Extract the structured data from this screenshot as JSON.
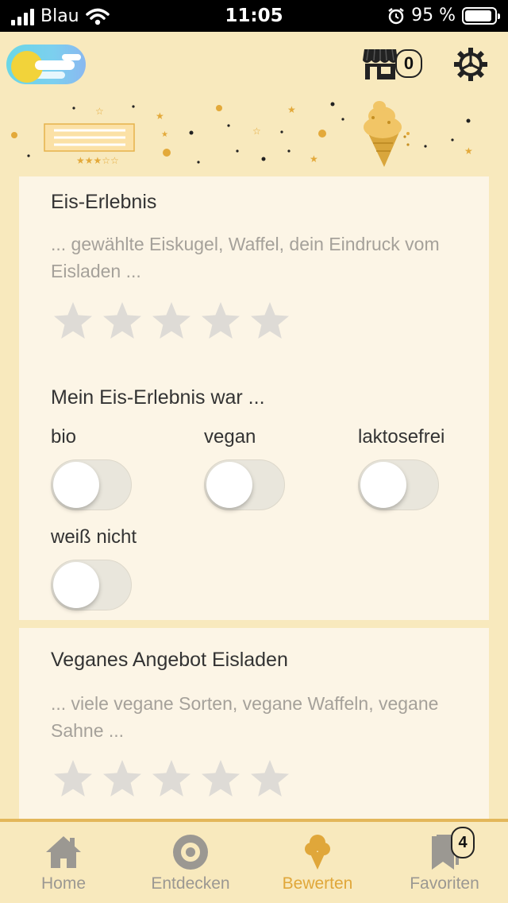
{
  "status_bar": {
    "carrier": "Blau",
    "time": "11:05",
    "battery": "95 %",
    "icons": [
      "signal-icon",
      "wifi-icon",
      "alarm-icon",
      "battery-icon"
    ]
  },
  "header": {
    "logo_icon": "sun-cloud-icon",
    "shop_icon": "shop-icon",
    "shop_count": "0",
    "settings_icon": "gear-icon"
  },
  "card1": {
    "title": "Eis-Erlebnis",
    "description": "... gewählte Eiskugel, Waffel, dein Eindruck vom Eisladen ...",
    "rating": 0,
    "rating_max": 5,
    "section_title": "Mein Eis-Erlebnis war ...",
    "toggles": [
      {
        "label": "bio",
        "on": false
      },
      {
        "label": "vegan",
        "on": false
      },
      {
        "label": "laktosefrei",
        "on": false
      },
      {
        "label": "weiß nicht",
        "on": false
      }
    ]
  },
  "card2": {
    "title": "Veganes Angebot Eisladen",
    "description": "... viele vegane Sorten, vegane Waffeln, vegane Sahne ...",
    "rating": 0,
    "rating_max": 5
  },
  "tabbar": {
    "tabs": [
      {
        "label": "Home",
        "icon": "home-icon"
      },
      {
        "label": "Entdecken",
        "icon": "target-icon"
      },
      {
        "label": "Bewerten",
        "icon": "ice-cream-icon",
        "active": true
      },
      {
        "label": "Favoriten",
        "icon": "bookmark-icon"
      }
    ],
    "favorites_count": "4"
  },
  "colors": {
    "background": "#f8e9bd",
    "card": "#fcf5e6",
    "accent": "#e0a73a",
    "star_empty": "#dedbd6"
  }
}
